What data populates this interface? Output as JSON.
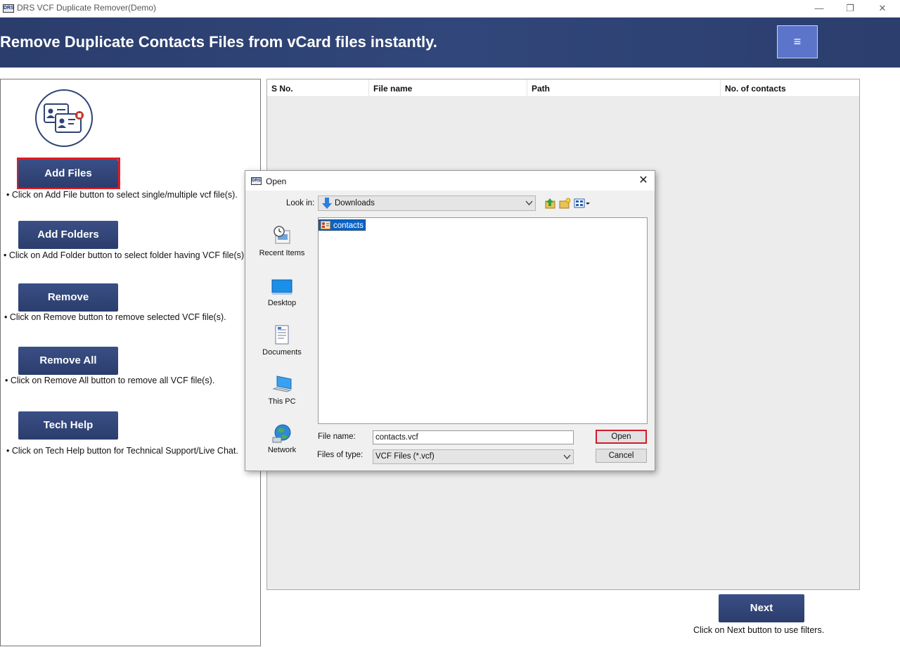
{
  "window": {
    "title": "DRS VCF Duplicate Remover(Demo)",
    "app_icon_text": "DRS",
    "minimize": "—",
    "restore": "❐",
    "close": "✕"
  },
  "header": {
    "title": "Remove Duplicate Contacts Files from vCard files instantly.",
    "menu_icon": "≡",
    "bg_color": "#2f4374"
  },
  "left_panel": {
    "buttons": [
      {
        "label": "Add Files",
        "hint": "• Click on Add File button to select single/multiple vcf file(s)."
      },
      {
        "label": "Add Folders",
        "hint": "• Click on Add Folder button to select folder having VCF file(s)."
      },
      {
        "label": "Remove",
        "hint": "• Click on Remove button to remove selected VCF file(s)."
      },
      {
        "label": "Remove All",
        "hint": "• Click on Remove All button to remove all VCF file(s)."
      },
      {
        "label": "Tech Help",
        "hint": "• Click on Tech Help button for Technical Support/Live Chat."
      }
    ],
    "button_color": "#2f4374",
    "highlight_color": "#e11b24"
  },
  "table": {
    "columns": [
      "S No.",
      "File name",
      "Path",
      "No. of contacts"
    ],
    "rows": []
  },
  "footer": {
    "next_label": "Next",
    "next_hint": "Click on Next button to use filters."
  },
  "dialog": {
    "title": "Open",
    "icon_text": "DRS",
    "close": "✕",
    "look_in_label": "Look in:",
    "look_in_value": "Downloads",
    "places": [
      "Recent Items",
      "Desktop",
      "Documents",
      "This PC",
      "Network"
    ],
    "files": [
      "contacts"
    ],
    "file_name_label": "File name:",
    "file_name_value": "contacts.vcf",
    "file_type_label": "Files of type:",
    "file_type_value": "VCF Files (*.vcf)",
    "open_label": "Open",
    "cancel_label": "Cancel"
  }
}
